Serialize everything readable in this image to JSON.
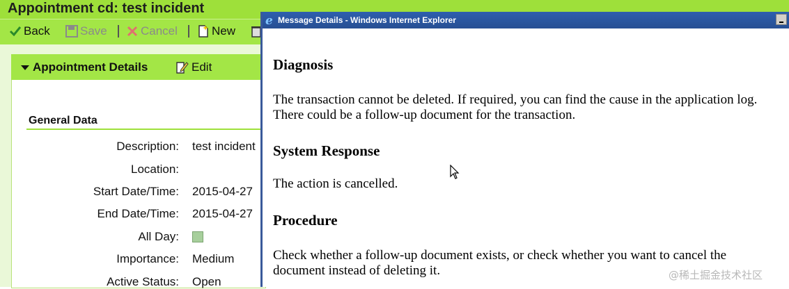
{
  "app": {
    "title": "Appointment cd: test incident",
    "toolbar": {
      "back": "Back",
      "save": "Save",
      "cancel": "Cancel",
      "new": "New"
    },
    "panel": {
      "title": "Appointment Details",
      "edit": "Edit"
    },
    "section": {
      "title": "General Data",
      "fields": [
        {
          "label": "Description:",
          "value": "test incident"
        },
        {
          "label": "Location:",
          "value": ""
        },
        {
          "label": "Start Date/Time:",
          "value": "2015-04-27"
        },
        {
          "label": "End Date/Time:",
          "value": "2015-04-27"
        },
        {
          "label": "All Day:",
          "value": ""
        },
        {
          "label": "Importance:",
          "value": "Medium"
        },
        {
          "label": "Active Status:",
          "value": "Open"
        }
      ]
    },
    "colors": {
      "accent_green": "#9ee03a",
      "dialog_titlebar": "#2e5fae"
    }
  },
  "dialog": {
    "title": "Message Details - Windows Internet Explorer",
    "sections": [
      {
        "heading": "Diagnosis",
        "text": "The transaction cannot be deleted. If required, you can find the cause in the application log. There could be a follow-up document for the transaction."
      },
      {
        "heading": "System Response",
        "text": "The action is cancelled."
      },
      {
        "heading": "Procedure",
        "text": "Check whether a follow-up document exists, or check whether you want to cancel the document instead of deleting it."
      }
    ]
  },
  "watermark": "@稀土掘金技术社区",
  "icons": [
    "checkmark-icon",
    "save-icon",
    "cancel-x-icon",
    "new-document-icon",
    "trash-icon",
    "edit-icon",
    "ie-logo-icon",
    "minimize-icon",
    "mouse-cursor-icon"
  ]
}
